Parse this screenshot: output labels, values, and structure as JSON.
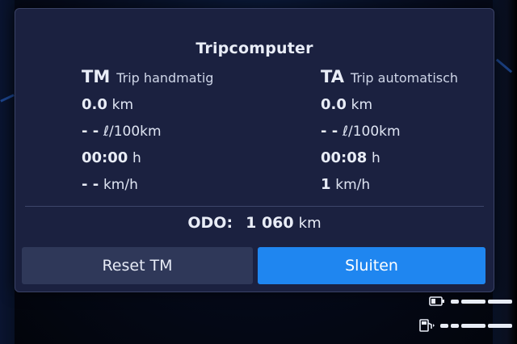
{
  "dialog": {
    "title": "Tripcomputer",
    "left": {
      "code": "TM",
      "name": "Trip handmatig",
      "distance": {
        "value": "0.0",
        "unit": "km"
      },
      "consumption": {
        "value": "- -",
        "unit": "ℓ/100km"
      },
      "time": {
        "value": "00:00",
        "unit": "h"
      },
      "speed": {
        "value": "- -",
        "unit": "km/h"
      }
    },
    "right": {
      "code": "TA",
      "name": "Trip automatisch",
      "distance": {
        "value": "0.0",
        "unit": "km"
      },
      "consumption": {
        "value": "- -",
        "unit": "ℓ/100km"
      },
      "time": {
        "value": "00:08",
        "unit": "h"
      },
      "speed": {
        "value": "1",
        "unit": "km/h"
      }
    },
    "odometer": {
      "label": "ODO:",
      "value": "1 060",
      "unit": "km"
    },
    "buttons": {
      "reset": "Reset TM",
      "close": "Sluiten"
    }
  },
  "status": {
    "battery_icon": "battery-icon",
    "fuel_icon": "fuel-pump-icon",
    "accent_color": "#1f86f0"
  }
}
